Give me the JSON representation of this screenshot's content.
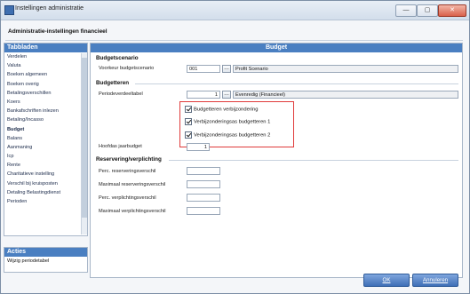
{
  "window": {
    "title": "Instellingen administratie",
    "controls": {
      "minimize": "—",
      "maximize": "▢",
      "close": "✕"
    }
  },
  "subtitle": "Administratie-instellingen financieel",
  "sidebar": {
    "header": "Tabbladen",
    "items": [
      {
        "label": "Verdelen"
      },
      {
        "label": "Valuta"
      },
      {
        "label": "Boeken algemeen"
      },
      {
        "label": "Boeken overig"
      },
      {
        "label": "Betalingsverschillen"
      },
      {
        "label": "Koers"
      },
      {
        "label": "Bankafschriften inlezen"
      },
      {
        "label": "Betaling/Incasso"
      },
      {
        "label": "Budget",
        "active": true
      },
      {
        "label": "Balans"
      },
      {
        "label": "Aanmaning"
      },
      {
        "label": "Icp"
      },
      {
        "label": "Rente"
      },
      {
        "label": "Charitatieve instelling"
      },
      {
        "label": "Verschil bij kruisposten"
      },
      {
        "label": "Detaling Belastingdienst"
      },
      {
        "label": "Perioden"
      }
    ]
  },
  "actions": {
    "header": "Acties",
    "items": [
      {
        "label": "Wijzig periodetabel"
      }
    ]
  },
  "budget": {
    "header": "Budget",
    "scenario_section": "Budgetscenario",
    "scenario_label": "Voorkeur budgetscenario",
    "scenario_code": "001",
    "scenario_name": "Profit Scenario",
    "budgets_section": "Budgetteren",
    "period_table_label": "Periodeverdeeltabel",
    "period_table_value": "1",
    "period_table_name": "Evenredig (Financieel)",
    "checkboxes": [
      {
        "label": "Budgetteren verbijzondering",
        "checked": true
      },
      {
        "label": "Verbijzonderingsas budgetteren 1",
        "checked": true
      },
      {
        "label": "Verbijzonderingsas budgetteren 2",
        "checked": true
      }
    ],
    "year_budget_label": "Hoofdas jaarbudget",
    "year_budget_value": "1",
    "reservation_section": "Reservering/verplichting",
    "reservation_fields": [
      {
        "label": "Perc. reserveringsverschil"
      },
      {
        "label": "Maximaal reserveringsverschil"
      },
      {
        "label": "Perc. verplichtingsverschil"
      },
      {
        "label": "Maximaal verplichtingsverschil"
      }
    ]
  },
  "footer": {
    "ok": "OK",
    "cancel": "Annuleren"
  }
}
